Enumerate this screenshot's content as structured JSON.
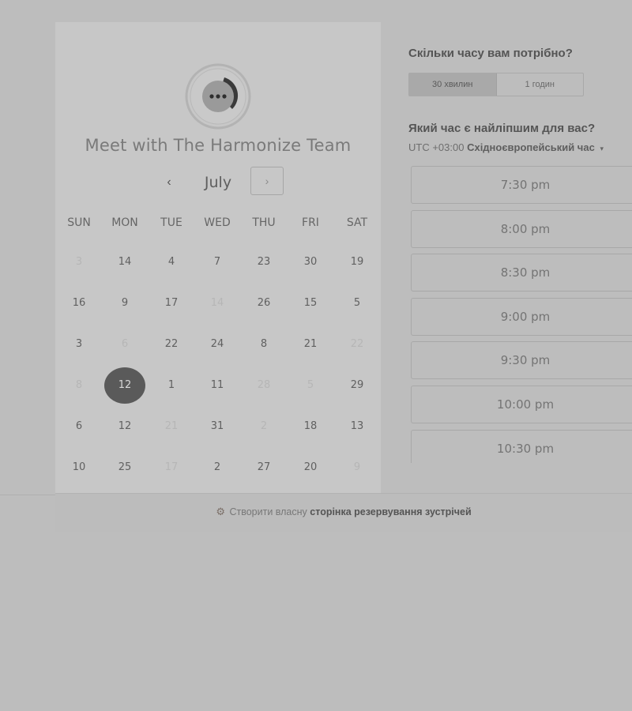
{
  "calendar": {
    "title": "Meet with The Harmonize Team",
    "month": "July",
    "prev_icon": "‹",
    "next_icon": "›",
    "weekdays": [
      "SUN",
      "MON",
      "TUE",
      "WED",
      "THU",
      "FRI",
      "SAT"
    ],
    "weeks": [
      [
        {
          "d": "3",
          "muted": true
        },
        {
          "d": "14"
        },
        {
          "d": "4"
        },
        {
          "d": "7"
        },
        {
          "d": "23"
        },
        {
          "d": "30"
        },
        {
          "d": "19"
        }
      ],
      [
        {
          "d": "16"
        },
        {
          "d": "9"
        },
        {
          "d": "17"
        },
        {
          "d": "14",
          "muted": true
        },
        {
          "d": "26"
        },
        {
          "d": "15"
        },
        {
          "d": "5"
        }
      ],
      [
        {
          "d": "3"
        },
        {
          "d": "6",
          "muted": true
        },
        {
          "d": "22"
        },
        {
          "d": "24"
        },
        {
          "d": "8"
        },
        {
          "d": "21"
        },
        {
          "d": "22",
          "muted": true
        }
      ],
      [
        {
          "d": "8",
          "muted": true
        },
        {
          "d": "12",
          "selected": true
        },
        {
          "d": "1"
        },
        {
          "d": "11"
        },
        {
          "d": "28",
          "muted": true
        },
        {
          "d": "5",
          "muted": true
        },
        {
          "d": "29"
        }
      ],
      [
        {
          "d": "6"
        },
        {
          "d": "12"
        },
        {
          "d": "21",
          "muted": true
        },
        {
          "d": "31"
        },
        {
          "d": "2",
          "muted": true
        },
        {
          "d": "18"
        },
        {
          "d": "13"
        }
      ],
      [
        {
          "d": "10"
        },
        {
          "d": "25"
        },
        {
          "d": "17",
          "muted": true
        },
        {
          "d": "2"
        },
        {
          "d": "27"
        },
        {
          "d": "20"
        },
        {
          "d": "9",
          "muted": true
        }
      ]
    ]
  },
  "scheduler": {
    "duration_question": "Скільки часу вам потрібно?",
    "durations": [
      "30 хвилин",
      "1 годин"
    ],
    "active_duration_index": 0,
    "time_question": "Який час є найліпшим для вас?",
    "timezone_offset": "UTC +03:00",
    "timezone_name": "Східноєвропейський час",
    "timezone_caret": "▾",
    "slots": [
      "7:30 pm",
      "8:00 pm",
      "8:30 pm",
      "9:00 pm",
      "9:30 pm",
      "10:00 pm",
      "10:30 pm"
    ]
  },
  "footer": {
    "sprocket": "⚙",
    "prefix": "Створити власну",
    "link": "сторінка резервування зустрічей"
  },
  "colors": {
    "overlay_bg": "#bdbdbd",
    "calendar_bg": "#c7c7c7",
    "selected_day": "#5a5a5a",
    "logo_dark": "#3a3a3a"
  }
}
